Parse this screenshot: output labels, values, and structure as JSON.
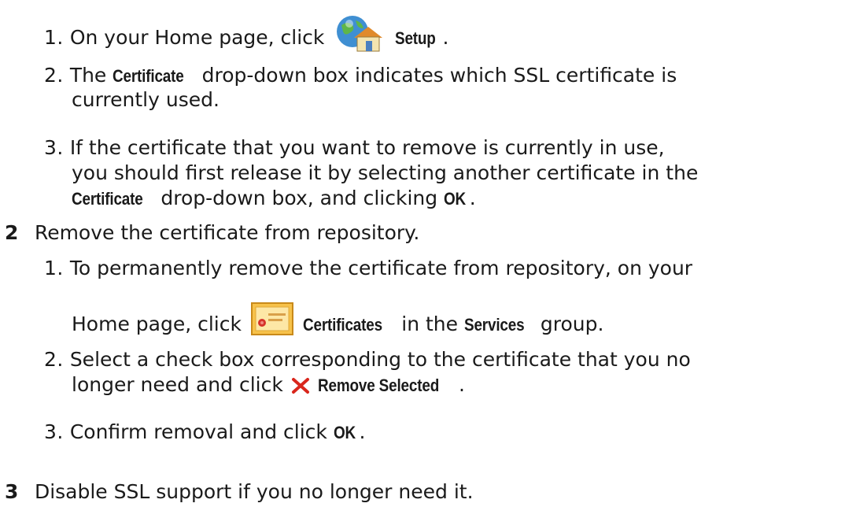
{
  "section1": {
    "item1": {
      "num": "1.",
      "text": "On your Home page, click",
      "icon": "home-globe-icon",
      "bold": "Setup",
      "end": "."
    },
    "item2": {
      "num": "2.",
      "pre": "The",
      "bold": "Certificate",
      "text": "drop-down box indicates which SSL certificate is",
      "line2": "currently used."
    },
    "item3": {
      "num": "3.",
      "line1": "If the certificate that you want to remove is currently in use,",
      "line2": "you should first release it by selecting another certificate in the",
      "bold1": "Certificate",
      "mid": "drop-down box, and clicking",
      "bold2": "OK",
      "end": "."
    }
  },
  "step2": {
    "num": "2",
    "title": "Remove the certificate from repository.",
    "item1": {
      "num": "1.",
      "line1": "To permanently remove the certificate from repository, on your",
      "pre": "Home page, click",
      "icon": "certificate-icon",
      "bold1": "Certificates",
      "mid": "in the",
      "bold2": "Services",
      "end": "group."
    },
    "item2": {
      "num": "2.",
      "line1": "Select a check box corresponding to the certificate that you no",
      "pre": "longer need and click",
      "icon": "remove-x-icon",
      "bold": "Remove Selected",
      "end": "."
    },
    "item3": {
      "num": "3.",
      "pre": "Confirm removal and click",
      "bold": "OK",
      "end": "."
    }
  },
  "step3": {
    "num": "3",
    "title": "Disable SSL support if you no longer need it."
  }
}
